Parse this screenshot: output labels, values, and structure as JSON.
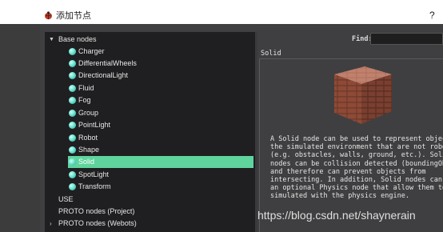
{
  "window": {
    "title": "添加节点",
    "help_label": "?"
  },
  "tree": {
    "base_nodes_label": "Base nodes",
    "base_nodes": [
      {
        "label": "Charger"
      },
      {
        "label": "DifferentialWheels"
      },
      {
        "label": "DirectionalLight"
      },
      {
        "label": "Fluid"
      },
      {
        "label": "Fog"
      },
      {
        "label": "Group"
      },
      {
        "label": "PointLight"
      },
      {
        "label": "Robot"
      },
      {
        "label": "Shape"
      },
      {
        "label": "Solid",
        "selected": true
      },
      {
        "label": "SpotLight"
      },
      {
        "label": "Transform"
      }
    ],
    "top_level": [
      {
        "label": "USE"
      },
      {
        "label": "PROTO nodes (Project)"
      },
      {
        "label": "PROTO nodes (Webots)"
      }
    ],
    "selection_color": "#5fd49d"
  },
  "search": {
    "label": "Find:",
    "value": ""
  },
  "info_panel": {
    "title": "Solid",
    "description_lines": [
      "A Solid node can be used to represent objects in",
      "the simulated environment that are not robots",
      "(e.g. obstacles, walls, ground, etc.). Solid",
      "nodes can be collision detected (boundingObject)",
      "and therefore can prevent objects from",
      "intersecting. In addition, Solid nodes can have",
      "an optional Physics node that allow them to be",
      "simulated with the physics engine."
    ]
  },
  "watermark": "https://blog.csdn.net/shaynerain"
}
